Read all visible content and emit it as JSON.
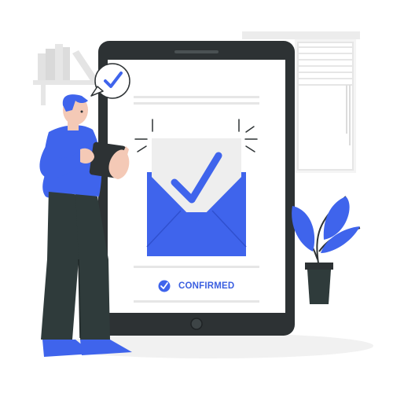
{
  "status": {
    "label": "CONFIRMED",
    "icon": "check-circle-icon"
  },
  "colors": {
    "accent": "#3f64ec",
    "dark": "#2f3b3b",
    "device_frame": "#2d3234",
    "screen": "#ffffff",
    "light_gray": "#ececec"
  },
  "icons": [
    "checkmark-bubble-icon",
    "envelope-icon",
    "checkmark-icon",
    "sparkle-icon",
    "home-button-icon"
  ]
}
